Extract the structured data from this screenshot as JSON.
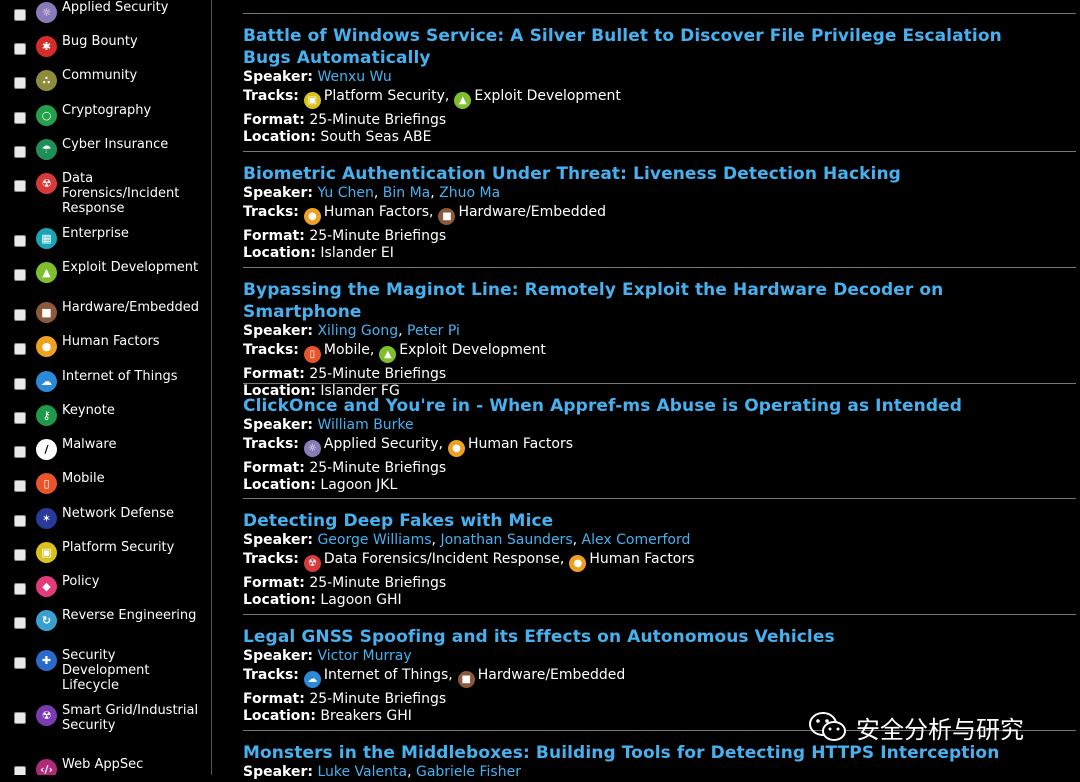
{
  "sidebar": {
    "items": [
      {
        "label": "Applied Security",
        "icon": "lock-icon",
        "color": "#8a7ab8",
        "glyph": "☼"
      },
      {
        "label": "Bug Bounty",
        "icon": "bug-icon",
        "color": "#d62b2b",
        "glyph": "✱"
      },
      {
        "label": "Community",
        "icon": "people-icon",
        "color": "#8e8b3c",
        "glyph": "∴"
      },
      {
        "label": "Cryptography",
        "icon": "magnifier-icon",
        "color": "#24a04a",
        "glyph": "○"
      },
      {
        "label": "Cyber Insurance",
        "icon": "umbrella-icon",
        "color": "#1f8f58",
        "glyph": "☂"
      },
      {
        "label": "Data Forensics/Incident Response",
        "icon": "biohazard-icon",
        "color": "#d63a3a",
        "glyph": "☢"
      },
      {
        "label": "Enterprise",
        "icon": "grid-icon",
        "color": "#1aa5b5",
        "glyph": "▦"
      },
      {
        "label": "Exploit Development",
        "icon": "flask-icon",
        "color": "#7fbf2e",
        "glyph": "▲"
      },
      {
        "label": "Hardware/Embedded",
        "icon": "chip-icon",
        "color": "#8b5a3c",
        "glyph": "■"
      },
      {
        "label": "Human Factors",
        "icon": "person-icon",
        "color": "#f0a020",
        "glyph": "●"
      },
      {
        "label": "Internet of Things",
        "icon": "cloud-icon",
        "color": "#2a8ad8",
        "glyph": "☁"
      },
      {
        "label": "Keynote",
        "icon": "key-icon",
        "color": "#1e9a4a",
        "glyph": "⚷"
      },
      {
        "label": "Malware",
        "icon": "syringe-icon",
        "color": "#ffffff",
        "glyph": "/"
      },
      {
        "label": "Mobile",
        "icon": "phone-icon",
        "color": "#e8552a",
        "glyph": "▯"
      },
      {
        "label": "Network Defense",
        "icon": "network-icon",
        "color": "#2a3a9a",
        "glyph": "✶"
      },
      {
        "label": "Platform Security",
        "icon": "platform-icon",
        "color": "#d7c21f",
        "glyph": "▣"
      },
      {
        "label": "Policy",
        "icon": "policy-icon",
        "color": "#e23a7a",
        "glyph": "◆"
      },
      {
        "label": "Reverse Engineering",
        "icon": "reverse-icon",
        "color": "#3aa0d0",
        "glyph": "↻"
      },
      {
        "label": "Security Development Lifecycle",
        "icon": "cycle-icon",
        "color": "#2a6ac8",
        "glyph": "✚"
      },
      {
        "label": "Smart Grid/Industrial Security",
        "icon": "radiation-icon",
        "color": "#7a3ab0",
        "glyph": "☢"
      },
      {
        "label": "Web AppSec",
        "icon": "code-icon",
        "color": "#b02a7a",
        "glyph": "‹/›"
      }
    ]
  },
  "labels": {
    "speaker": "Speaker:",
    "tracks": "Tracks:",
    "format": "Format:",
    "location": "Location:"
  },
  "talks": [
    {
      "title": "Battle of Windows Service: A Silver Bullet to Discover File Privilege Escalation Bugs Automatically",
      "speakers": [
        "Wenxu Wu"
      ],
      "tracks": [
        {
          "name": "Platform Security",
          "icon": "platform-icon",
          "color": "#d7c21f",
          "glyph": "▣"
        },
        {
          "name": "Exploit Development",
          "icon": "flask-icon",
          "color": "#7fbf2e",
          "glyph": "▲"
        }
      ],
      "format": "25-Minute Briefings",
      "location": "South Seas ABE"
    },
    {
      "title": "Biometric Authentication Under Threat: Liveness Detection Hacking",
      "speakers": [
        "Yu Chen",
        "Bin Ma",
        "Zhuo Ma"
      ],
      "tracks": [
        {
          "name": "Human Factors",
          "icon": "person-icon",
          "color": "#f0a020",
          "glyph": "●"
        },
        {
          "name": "Hardware/Embedded",
          "icon": "chip-icon",
          "color": "#8b5a3c",
          "glyph": "■"
        }
      ],
      "format": "25-Minute Briefings",
      "location": "Islander EI"
    },
    {
      "title": "Bypassing the Maginot Line: Remotely Exploit the Hardware Decoder on Smartphone",
      "speakers": [
        "Xiling Gong",
        "Peter Pi"
      ],
      "tracks": [
        {
          "name": "Mobile",
          "icon": "phone-icon",
          "color": "#e8552a",
          "glyph": "▯"
        },
        {
          "name": "Exploit Development",
          "icon": "flask-icon",
          "color": "#7fbf2e",
          "glyph": "▲"
        }
      ],
      "format": "25-Minute Briefings",
      "location": "Islander FG"
    },
    {
      "title": "ClickOnce and You're in - When Appref-ms Abuse is Operating as Intended",
      "speakers": [
        "William Burke"
      ],
      "tracks": [
        {
          "name": "Applied Security",
          "icon": "lock-icon",
          "color": "#8a7ab8",
          "glyph": "☼"
        },
        {
          "name": "Human Factors",
          "icon": "person-icon",
          "color": "#f0a020",
          "glyph": "●"
        }
      ],
      "format": "25-Minute Briefings",
      "location": "Lagoon JKL"
    },
    {
      "title": "Detecting Deep Fakes with Mice",
      "speakers": [
        "George Williams",
        "Jonathan Saunders",
        "Alex Comerford"
      ],
      "tracks": [
        {
          "name": "Data Forensics/Incident Response",
          "icon": "biohazard-icon",
          "color": "#d63a3a",
          "glyph": "☢"
        },
        {
          "name": "Human Factors",
          "icon": "person-icon",
          "color": "#f0a020",
          "glyph": "●"
        }
      ],
      "format": "25-Minute Briefings",
      "location": "Lagoon GHI"
    },
    {
      "title": "Legal GNSS Spoofing and its Effects on Autonomous Vehicles",
      "speakers": [
        "Victor Murray"
      ],
      "tracks": [
        {
          "name": "Internet of Things",
          "icon": "cloud-icon",
          "color": "#2a8ad8",
          "glyph": "☁"
        },
        {
          "name": "Hardware/Embedded",
          "icon": "chip-icon",
          "color": "#8b5a3c",
          "glyph": "■"
        }
      ],
      "format": "25-Minute Briefings",
      "location": "Breakers GHI"
    },
    {
      "title": "Monsters in the Middleboxes: Building Tools for Detecting HTTPS Interception",
      "speakers": [
        "Luke Valenta",
        "Gabriele Fisher"
      ],
      "tracks": [],
      "format": "",
      "location": ""
    }
  ],
  "watermark": {
    "text": "安全分析与研究",
    "icon": "wechat-icon"
  }
}
